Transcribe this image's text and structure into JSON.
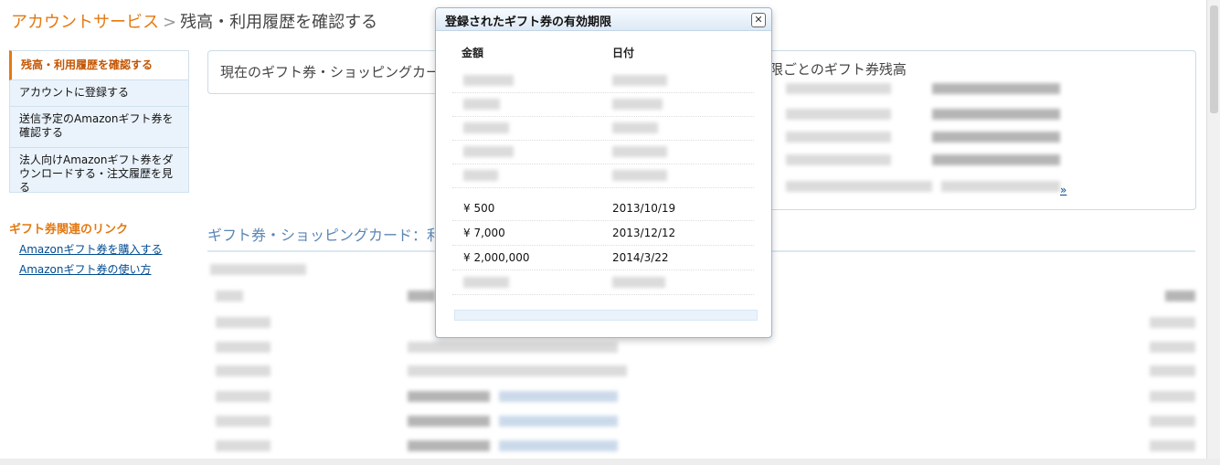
{
  "breadcrumb": {
    "parent": "アカウントサービス",
    "separator": ">",
    "current": "残高・利用履歴を確認する"
  },
  "sidebar": {
    "items": [
      {
        "label": "残高・利用履歴を確認する",
        "active": true
      },
      {
        "label": "アカウントに登録する",
        "active": false
      },
      {
        "label": "送信予定のAmazonギフト券を確認する",
        "active": false
      },
      {
        "label": "法人向けAmazonギフト券をダウンロードする・注文履歴を見る",
        "active": false
      }
    ],
    "related_heading": "ギフト券関連のリンク",
    "related_links": [
      "Amazonギフト券を購入する",
      "Amazonギフト券の使い方"
    ]
  },
  "balance_box": {
    "title": "現在のギフト券・ショッピングカード"
  },
  "expiry_box": {
    "title": "限ごとのギフト券残高",
    "link": "»"
  },
  "history": {
    "title": "ギフト券・ショッピングカード：利用"
  },
  "modal": {
    "title": "登録されたギフト券の有効期限",
    "close_label": "✕",
    "headers": {
      "amount": "金額",
      "date": "日付"
    },
    "rows": [
      {
        "amount": "¥ 500",
        "date": "2013/10/19"
      },
      {
        "amount": "¥ 7,000",
        "date": "2013/12/12"
      },
      {
        "amount": "¥ 2,000,000",
        "date": "2014/3/22"
      }
    ]
  },
  "colors": {
    "accent": "#e47911",
    "link": "#004b91",
    "sidebar_bg": "#eaf3fb",
    "heading_blue": "#5b86b5"
  }
}
